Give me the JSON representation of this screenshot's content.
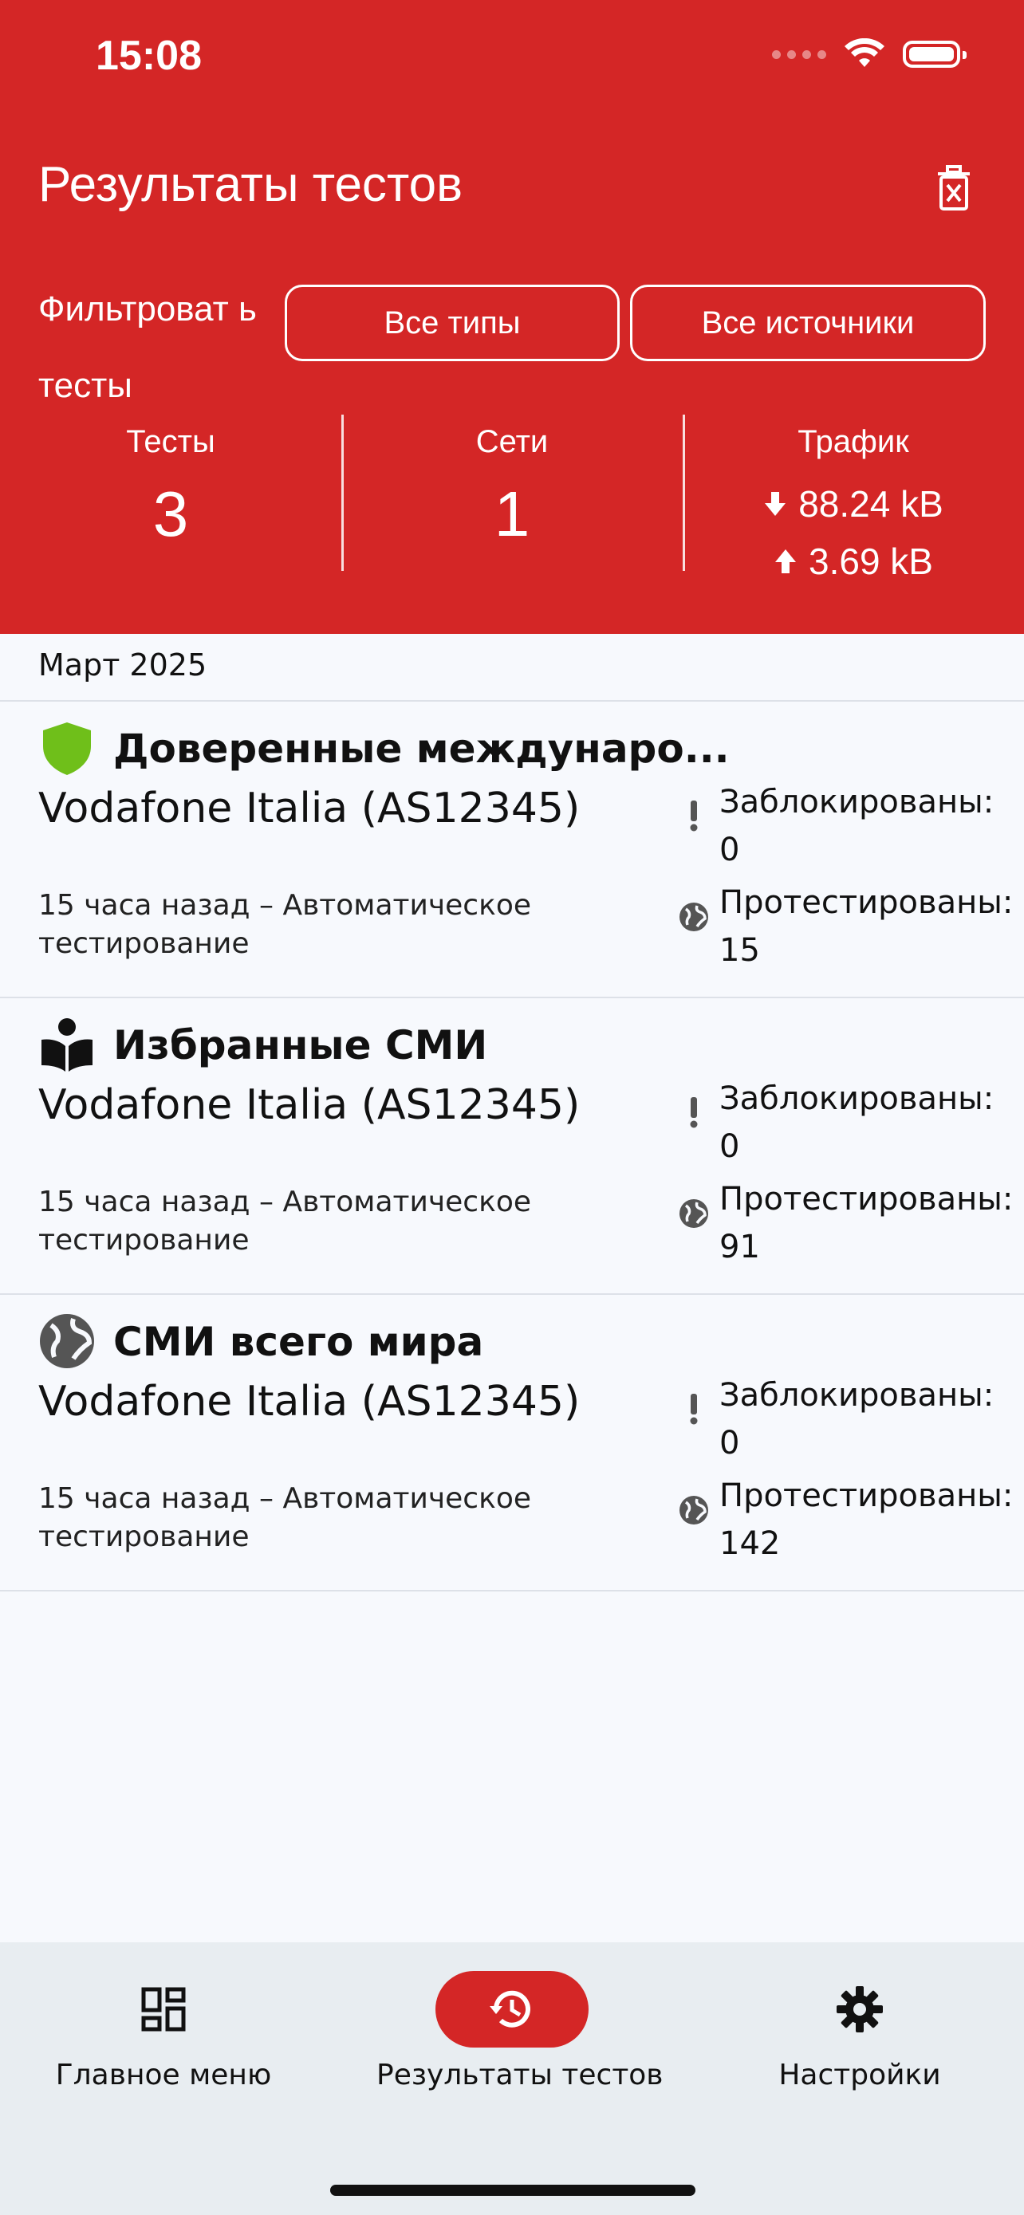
{
  "status_bar": {
    "time": "15:08"
  },
  "header": {
    "title": "Результаты тестов",
    "filter_label": "Фильтроват ь тесты",
    "filter_types": "Все типы",
    "filter_sources": "Все источники"
  },
  "summary": {
    "tests_label": "Тесты",
    "tests_value": "3",
    "networks_label": "Сети",
    "networks_value": "1",
    "traffic_label": "Трафик",
    "download": "88.24 kB",
    "upload": "3.69 kB"
  },
  "section": {
    "label": "Март 2025"
  },
  "results": [
    {
      "icon": "shield-icon",
      "title": "Доверенные междунаро...",
      "network": "Vodafone Italia (AS12345)",
      "meta": "15 часа назад – Автоматическое тестирование",
      "blocked": "Заблокированы: 0",
      "tested": "Протестированы: 15"
    },
    {
      "icon": "reader-icon",
      "title": "Избранные СМИ",
      "network": "Vodafone Italia (AS12345)",
      "meta": "15 часа назад – Автоматическое тестирование",
      "blocked": "Заблокированы: 0",
      "tested": "Протестированы: 91"
    },
    {
      "icon": "globe-icon",
      "title": "СМИ всего мира",
      "network": "Vodafone Italia (AS12345)",
      "meta": "15 часа назад – Автоматическое тестирование",
      "blocked": "Заблокированы: 0",
      "tested": "Протестированы: 142"
    }
  ],
  "nav": {
    "home": "Главное меню",
    "results": "Результаты тестов",
    "settings": "Настройки"
  },
  "colors": {
    "accent": "#d42626",
    "shield": "#6fbf1a",
    "icon_gray": "#555555"
  }
}
